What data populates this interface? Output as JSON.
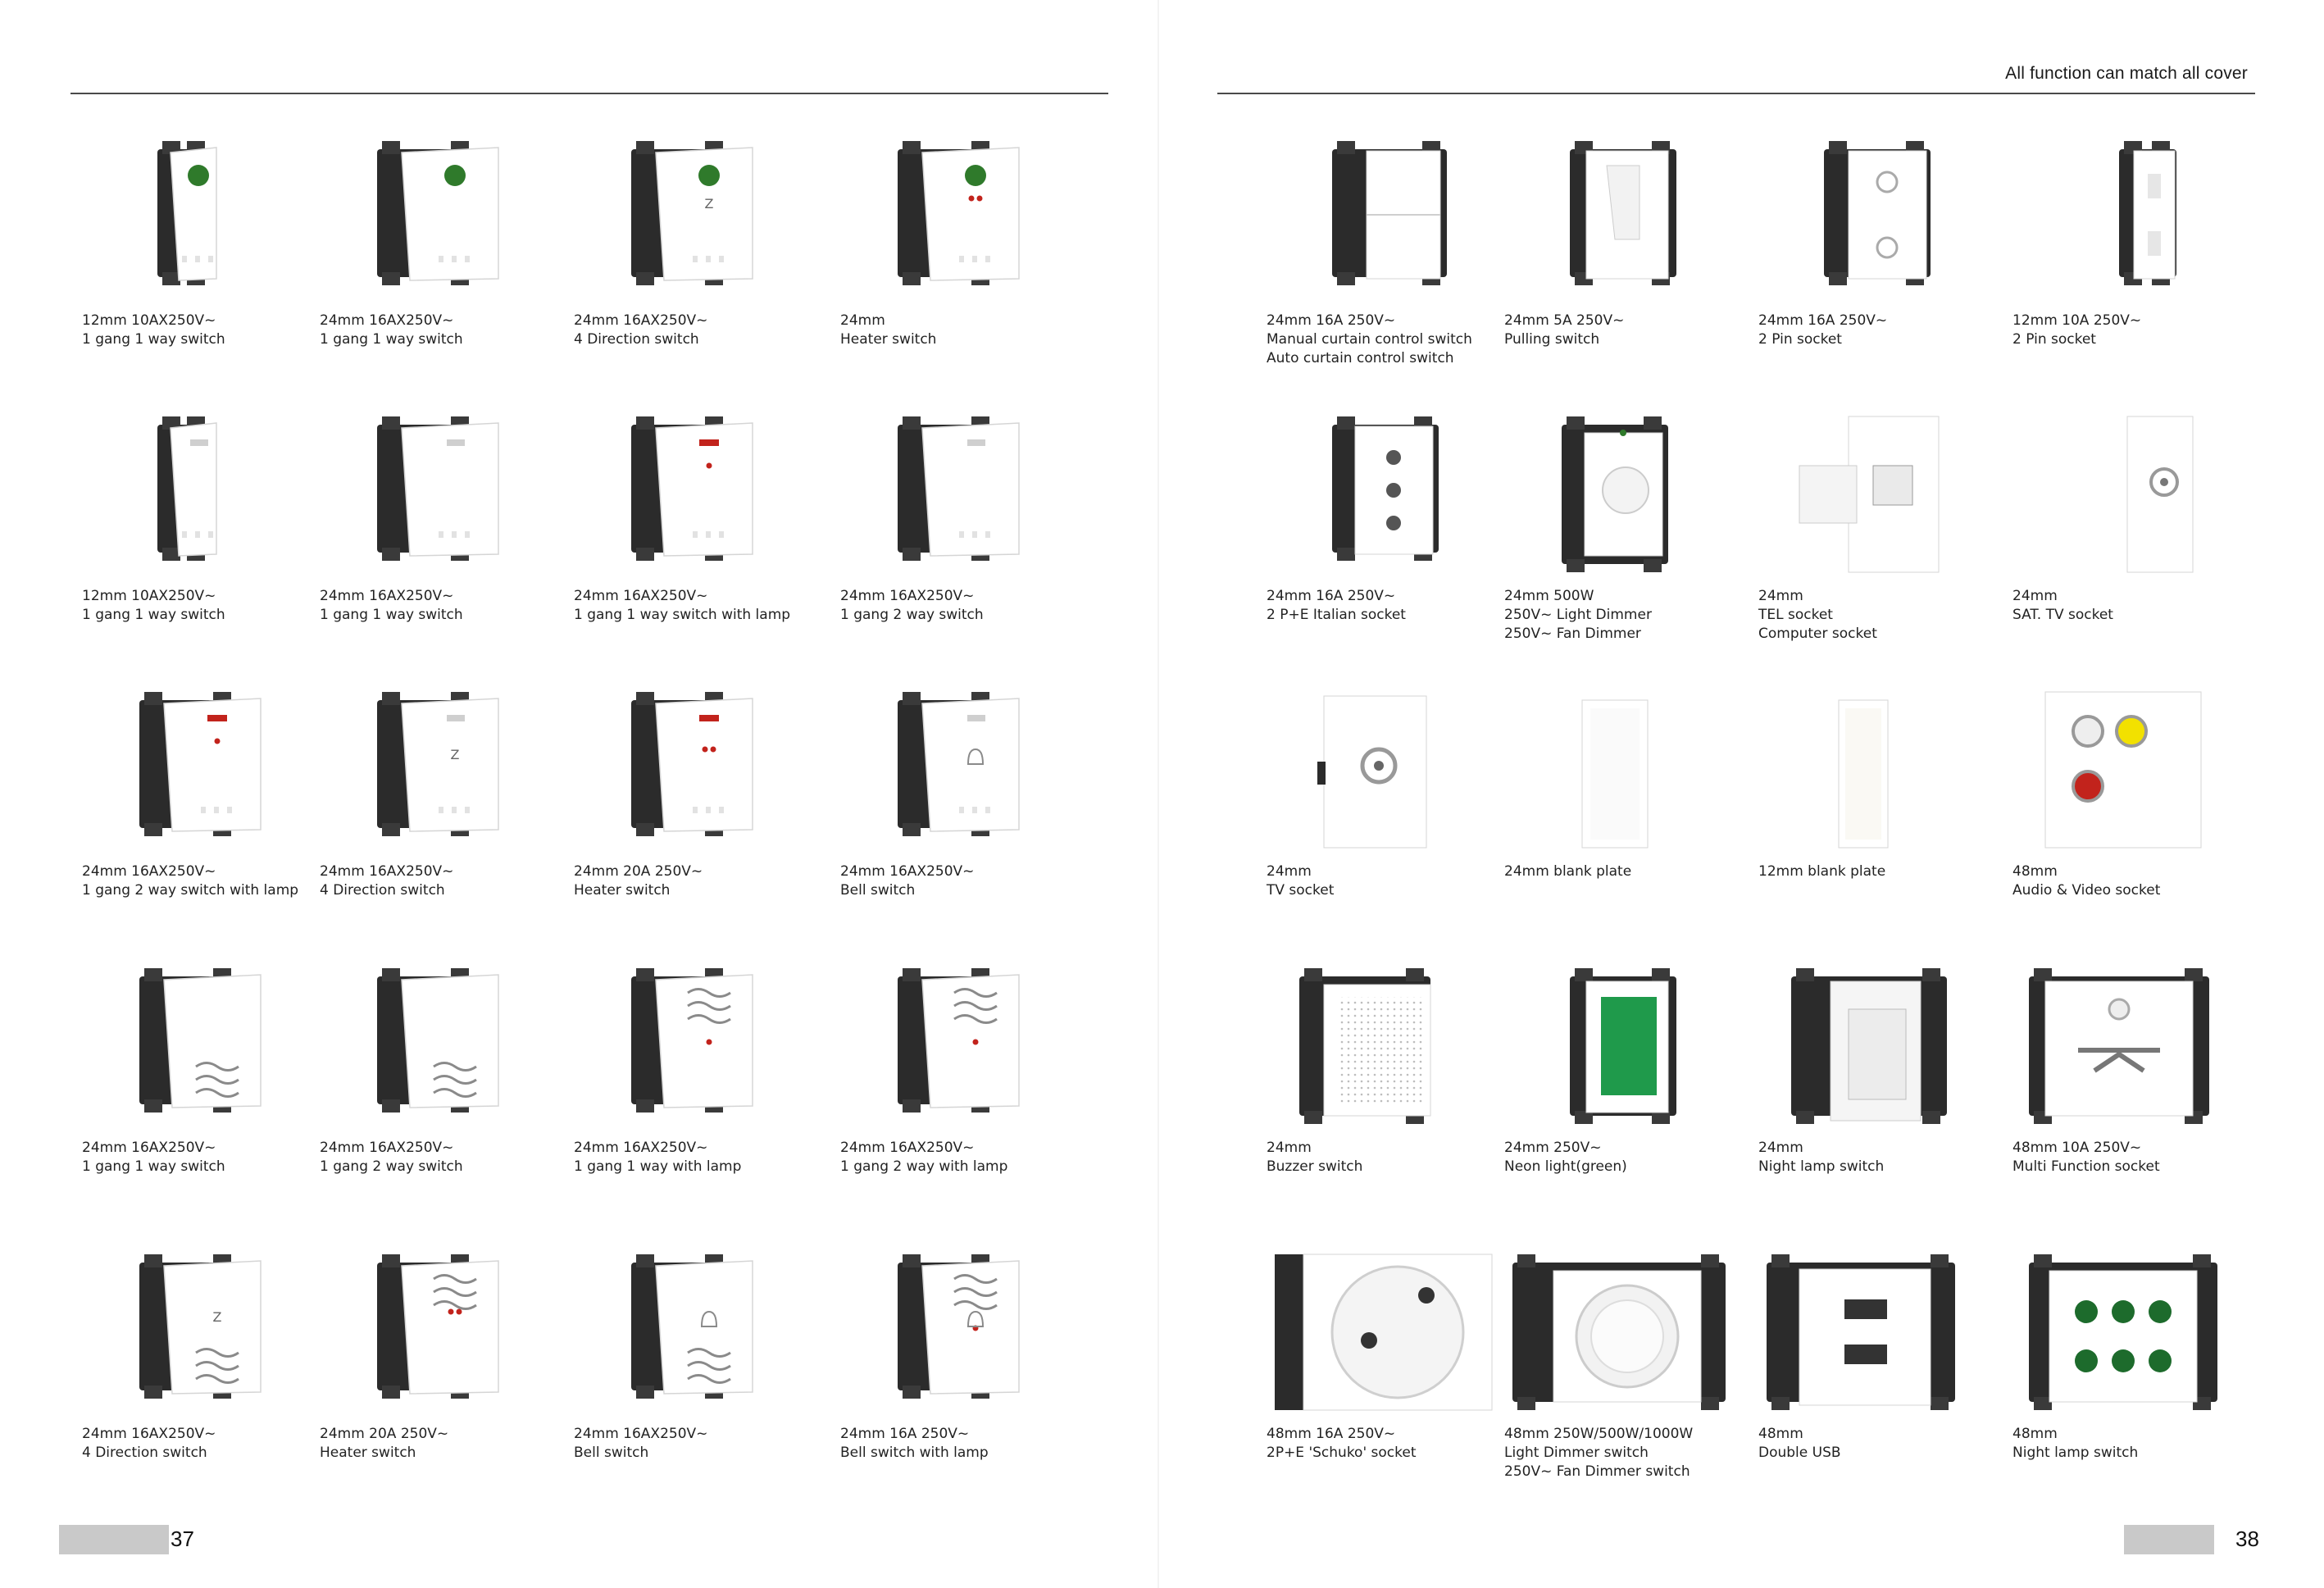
{
  "header_note": "All function can match all cover",
  "page_numbers": {
    "left": "37",
    "right": "38"
  },
  "left_products": [
    {
      "lines": [
        "12mm 10AX250V~",
        "1 gang 1 way switch"
      ],
      "icon": "switch-narrow-green-lamp-icon"
    },
    {
      "lines": [
        "24mm 16AX250V~",
        "1 gang 1 way switch"
      ],
      "icon": "switch-green-lamp-icon"
    },
    {
      "lines": [
        "24mm 16AX250V~",
        "4 Direction switch"
      ],
      "icon": "switch-green-lamp-z-icon"
    },
    {
      "lines": [
        "24mm",
        "Heater  switch"
      ],
      "icon": "switch-green-lamp-heater-icon"
    },
    {
      "lines": [
        "12mm 10AX250V~",
        "1 gang 1 way switch"
      ],
      "icon": "switch-narrow-icon"
    },
    {
      "lines": [
        "24mm 16AX250V~",
        "1 gang 1 way switch"
      ],
      "icon": "switch-rocker-icon"
    },
    {
      "lines": [
        "24mm 16AX250V~",
        "1 gang 1 way switch with lamp"
      ],
      "icon": "switch-red-lamp-icon"
    },
    {
      "lines": [
        "24mm 16AX250V~",
        "1 gang 2 way switch"
      ],
      "icon": "switch-rocker-2way-icon"
    },
    {
      "lines": [
        "24mm 16AX250V~",
        "1 gang 2 way switch with lamp"
      ],
      "icon": "switch-red-lamp-2way-icon"
    },
    {
      "lines": [
        "24mm 16AX250V~",
        "4 Direction switch"
      ],
      "icon": "switch-z-icon"
    },
    {
      "lines": [
        "24mm 20A 250V~",
        "Heater switch"
      ],
      "icon": "switch-heater-red-icon"
    },
    {
      "lines": [
        "24mm 16AX250V~",
        "Bell switch"
      ],
      "icon": "switch-bell-icon"
    },
    {
      "lines": [
        "24mm 16AX250V~",
        "1 gang 1 way switch"
      ],
      "icon": "switch-wave-icon"
    },
    {
      "lines": [
        "24mm 16AX250V~",
        "1 gang 2 way switch"
      ],
      "icon": "switch-wave-2way-icon"
    },
    {
      "lines": [
        "24mm 16AX250V~",
        "1 gang 1 way with lamp"
      ],
      "icon": "switch-wave-lamp-icon"
    },
    {
      "lines": [
        "24mm 16AX250V~",
        "1 gang 2 way with lamp"
      ],
      "icon": "switch-wave-2way-lamp-icon"
    },
    {
      "lines": [
        "24mm 16AX250V~",
        "4 Direction switch"
      ],
      "icon": "switch-wave-z-icon"
    },
    {
      "lines": [
        "24mm 20A 250V~",
        "Heater switch"
      ],
      "icon": "switch-wave-heater-icon"
    },
    {
      "lines": [
        "24mm 16AX250V~",
        "Bell switch"
      ],
      "icon": "switch-wave-bell-icon"
    },
    {
      "lines": [
        "24mm 16A 250V~",
        "Bell switch with lamp"
      ],
      "icon": "switch-wave-bell-lamp-icon"
    }
  ],
  "right_products": [
    {
      "lines": [
        "24mm 16A 250V~",
        "Manual curtain control switch",
        "Auto curtain control switch"
      ],
      "icon": "curtain-switch-icon"
    },
    {
      "lines": [
        "24mm 5A 250V~",
        "Pulling  switch"
      ],
      "icon": "pulling-switch-icon"
    },
    {
      "lines": [
        "24mm 16A 250V~",
        "2 Pin socket"
      ],
      "icon": "two-pin-socket-icon"
    },
    {
      "lines": [
        "12mm 10A 250V~",
        "2 Pin socket"
      ],
      "icon": "two-pin-socket-narrow-icon"
    },
    {
      "lines": [
        "24mm 16A 250V~",
        "2 P+E Italian socket"
      ],
      "icon": "italian-socket-icon"
    },
    {
      "lines": [
        "24mm 500W",
        "250V~ Light  Dimmer",
        "250V~  Fan  Dimmer"
      ],
      "icon": "dimmer-icon"
    },
    {
      "lines": [
        "24mm",
        "TEL  socket",
        "Computer   socket"
      ],
      "icon": "tel-socket-icon"
    },
    {
      "lines": [
        "24mm",
        "SAT. TV   socket"
      ],
      "icon": "sat-tv-socket-icon"
    },
    {
      "lines": [
        "24mm",
        "TV socket"
      ],
      "icon": "tv-socket-icon"
    },
    {
      "lines": [
        "24mm blank plate"
      ],
      "icon": "blank-plate-icon"
    },
    {
      "lines": [
        "12mm blank plate"
      ],
      "icon": "blank-plate-narrow-icon"
    },
    {
      "lines": [
        "48mm",
        "Audio  &  Video  socket"
      ],
      "icon": "av-socket-icon"
    },
    {
      "lines": [
        "24mm",
        "Buzzer  switch"
      ],
      "icon": "buzzer-icon"
    },
    {
      "lines": [
        "24mm 250V~",
        "Neon light(green)"
      ],
      "icon": "neon-light-icon"
    },
    {
      "lines": [
        "24mm",
        "Night  lamp  switch"
      ],
      "icon": "night-lamp-icon"
    },
    {
      "lines": [
        "48mm  10A  250V~",
        "Multi  Function  socket"
      ],
      "icon": "multi-socket-icon"
    },
    {
      "lines": [
        "48mm 16A 250V~",
        "2P+E 'Schuko' socket"
      ],
      "icon": "schuko-socket-icon"
    },
    {
      "lines": [
        "48mm  250W/500W/1000W",
        "Light  Dimmer  switch",
        "250V~  Fan  Dimmer  switch"
      ],
      "icon": "dimmer-large-icon"
    },
    {
      "lines": [
        "48mm",
        "Double  USB"
      ],
      "icon": "usb-icon"
    },
    {
      "lines": [
        "48mm",
        "Night  lamp  switch"
      ],
      "icon": "night-lamp-6-icon"
    }
  ],
  "colors": {
    "frame": "#2b2b2b",
    "face": "#ffffff",
    "green_lamp": "#2f7a2b",
    "red_lamp": "#c2231c",
    "yellow": "#f2e100"
  }
}
